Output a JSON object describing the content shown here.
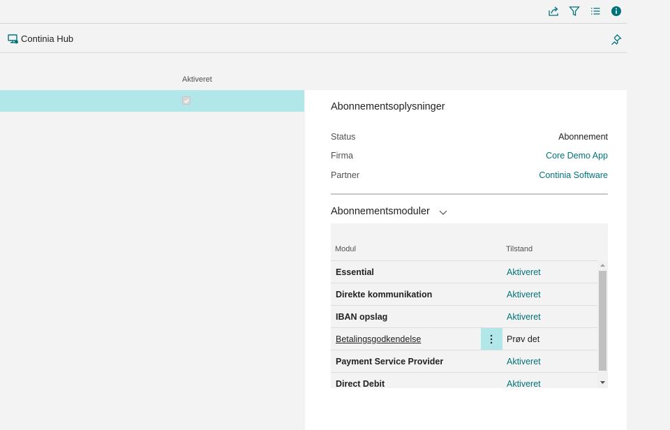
{
  "toolbar": {
    "icons": [
      "share-icon",
      "filter-icon",
      "list-icon",
      "info-icon"
    ],
    "accent": "#00727a"
  },
  "page": {
    "app_title": "Continia Hub",
    "app_icon": "monitor-icon",
    "pin_icon": "pin-icon"
  },
  "list": {
    "column_header": "Aktiveret",
    "rows": [
      {
        "aktiveret": true,
        "selected": true
      }
    ],
    "selected_row_color": "#b2e7ea"
  },
  "factbox": {
    "title": "Abonnementsoplysninger",
    "fields": [
      {
        "label": "Status",
        "value": "Abonnement",
        "link": false
      },
      {
        "label": "Firma",
        "value": "Core Demo App",
        "link": true
      },
      {
        "label": "Partner",
        "value": "Continia Software",
        "link": true
      }
    ],
    "modules": {
      "title": "Abonnementsmoduler",
      "columns": [
        "Modul",
        "Tilstand"
      ],
      "rows": [
        {
          "modul": "Essential",
          "tilstand": "Aktiveret"
        },
        {
          "modul": "Direkte kommunikation",
          "tilstand": "Aktiveret"
        },
        {
          "modul": "IBAN opslag",
          "tilstand": "Aktiveret"
        },
        {
          "modul": "Betalingsgodkendelse",
          "tilstand": "Prøv det"
        },
        {
          "modul": "Payment Service Provider",
          "tilstand": "Aktiveret"
        },
        {
          "modul": "Direct Debit",
          "tilstand": "Aktiveret"
        }
      ]
    }
  }
}
